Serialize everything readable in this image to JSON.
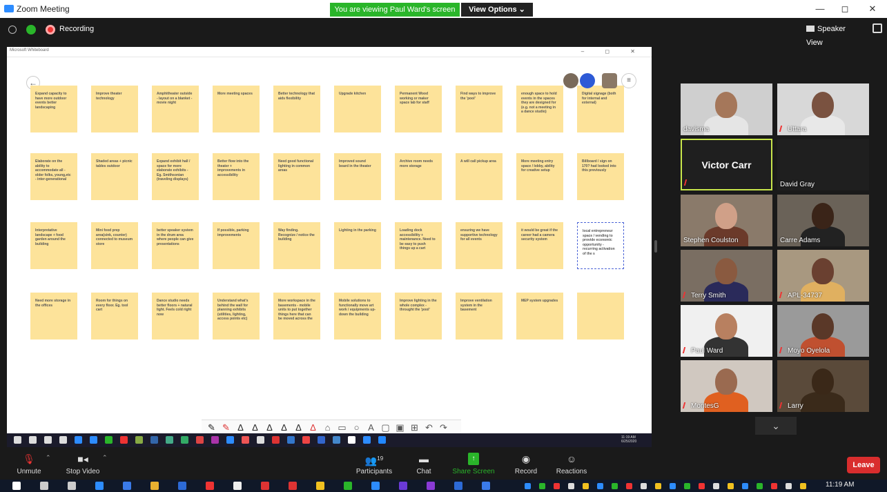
{
  "window": {
    "title": "Zoom Meeting",
    "minimize": "—",
    "restore": "◻",
    "close": "✕"
  },
  "banner": {
    "viewing": "You are viewing Paul Ward's screen",
    "view_options": "View Options ⌄"
  },
  "topbar": {
    "recording": "Recording",
    "speaker_view": "Speaker View"
  },
  "whiteboard": {
    "app_title": "Microsoft Whiteboard",
    "window_controls": "–  ◻  ✕",
    "back": "←",
    "notes": [
      "Expand capacity to have more outdoor events better landscaping",
      "Improve theater technology",
      "Amphitheater outside - layout on a blanket - movie night",
      "More meeting spaces",
      "Better technology that aids flexibility",
      "Upgrade kitchen",
      "Permanent Wood working or maker space lab for staff",
      "Find ways to improve the 'pool'",
      "enough space to hold events in the spaces they are designed for (e.g. not a meeting in a dance studio)",
      "Digital signage (both for internal and external)",
      "Elaborate on the ability to accommodate all - older folks, young,etc - inter-generational",
      "Shaded areas + picnic tables outdoor",
      "Expand exhibit hall / space for more elaborate exhibits - Eg. Smithsonian (traveling displays)",
      "Better flow into the theater + improvements in accessibility",
      "Need good functional lighting in common areas",
      "Improved sound board in the theater",
      "Archive room needs more storage",
      "A will call pickup area",
      "More meeting entry space / lobby, ability for creative setup",
      "Billboard / sign on 170? had looked into this previously",
      "Interpretative landscape + food garden around the building",
      "Mini food prep area(sink, counter) connected to museum store",
      "better speaker system in the drum area where people can give presentations",
      "If possible, parking improvements",
      "Way finding. Recognize / notice the building",
      "Lighting in the parking",
      "Loading dock accessibility + maintenance. Need to be easy to push things up a cart",
      "ensuring we have supportive technology for all events",
      "it would be great if the career had a camera security system",
      "local entrepreneur space / vending to provide economic opportunity - recurring activation of the s",
      "Need more storage in the offices",
      "Room for things on every floor. Eg. tool cart",
      "Dance studio needs better floors + natural light. Feels cold right now",
      "Understand what's behind the wall for planning exhibits (utilities, lighting, access points etc)",
      "More workspace in the basements - mobile units to put together things here that can be moved across the",
      "Mobile solutions to functionally move art work / equipments up-down the building",
      "Improve lighting in the whole complex - throught the 'pool'",
      "Improve ventilation system in the basement",
      "MEP system upgrades",
      ""
    ],
    "pen_tools": [
      "✎",
      "✎",
      "∆",
      "∆",
      "∆",
      "∆",
      "∆",
      "∆",
      "⌂",
      "▭",
      "○",
      "A",
      "▢",
      "▣",
      "⊞",
      "↶",
      "↷"
    ],
    "remote_clock": "11:19 AM\n6/25/2020"
  },
  "gallery": {
    "participants": [
      {
        "name": "davisma",
        "muted": false
      },
      {
        "name": "Uttara",
        "muted": true
      },
      {
        "name": "Victor Carr",
        "muted": true
      },
      {
        "name": "David Gray",
        "muted": false
      },
      {
        "name": "Stephen Coulston",
        "muted": false
      },
      {
        "name": "Carre Adams",
        "muted": false
      },
      {
        "name": "Terry Smith",
        "muted": true
      },
      {
        "name": "APL-34737",
        "muted": true
      },
      {
        "name": "Paul Ward",
        "muted": true
      },
      {
        "name": "Moyo Oyelola",
        "muted": true
      },
      {
        "name": "MontesG",
        "muted": true
      },
      {
        "name": "Larry",
        "muted": true
      }
    ],
    "scroll_down": "⌄"
  },
  "controls": {
    "unmute": "Unmute",
    "stop_video": "Stop Video",
    "participants": "Participants",
    "participants_count": "19",
    "chat": "Chat",
    "share_screen": "Share Screen",
    "record": "Record",
    "reactions": "Reactions",
    "leave": "Leave"
  },
  "taskbar": {
    "clock": "11:19 AM"
  },
  "colors": {
    "accent": "#2d8cff",
    "banner": "#2ab52a",
    "leave": "#d92d2d",
    "sticky": "#fde39a",
    "active_speaker": "#c8e64b"
  }
}
